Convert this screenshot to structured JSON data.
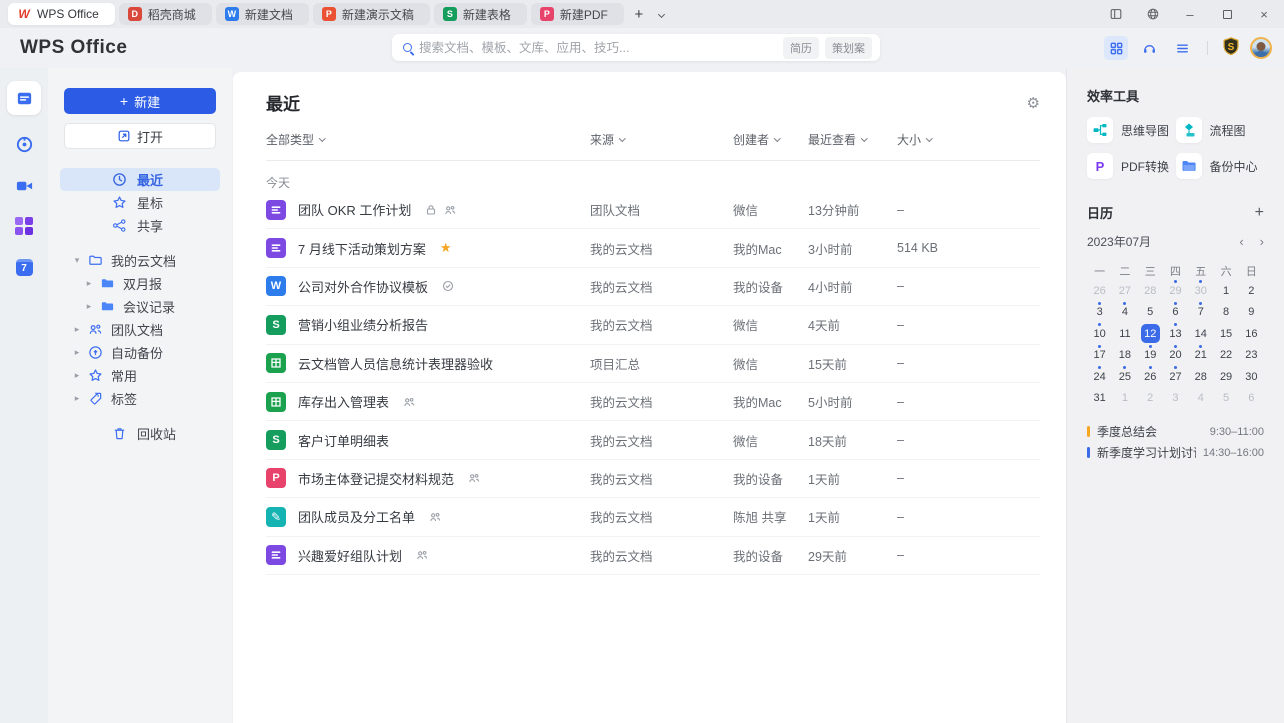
{
  "glyphs": {
    "plus": "+",
    "minimize": "–",
    "close": "×",
    "prev": "‹",
    "next": "›"
  },
  "colors": {
    "accent_blue": "#2c5ce5",
    "writer_blue": "#2d7ceb",
    "presentation_orange": "#eb5233",
    "spreadsheet_green": "#159d5d",
    "pdf_rose": "#e8436a",
    "docs_purple": "#7d49e3",
    "smartdoc_teal": "#16b3b3",
    "docer_red": "#d9483b",
    "star_orange": "#f5a623",
    "selected_day_blue": "#3b6be8"
  },
  "tabbar": {
    "tabs": [
      {
        "label": "WPS Office",
        "glyph": "W",
        "active": true
      },
      {
        "label": "稻壳商城",
        "glyph": "D"
      },
      {
        "label": "新建文档",
        "glyph": "W"
      },
      {
        "label": "新建演示文稿",
        "glyph": "P"
      },
      {
        "label": "新建表格",
        "glyph": "S"
      },
      {
        "label": "新建PDF",
        "glyph": "P"
      }
    ]
  },
  "header": {
    "logo": "WPS Office",
    "search": {
      "placeholder": "搜索文档、模板、文库、应用、技巧...",
      "tags": [
        "简历",
        "策划案"
      ]
    },
    "icons": [
      "apps-grid-icon",
      "support-headset-icon",
      "menu-icon",
      "member-shield-icon",
      "avatar"
    ]
  },
  "rail": {
    "items": [
      "docs-icon",
      "meeting-icon",
      "video-icon",
      "apps-icon",
      "calendar-icon"
    ]
  },
  "sidebar": {
    "new_button": "新建",
    "open_button": "打开",
    "nav": [
      {
        "label": "最近",
        "icon": "clock",
        "active": true
      },
      {
        "label": "星标",
        "icon": "star"
      },
      {
        "label": "共享",
        "icon": "share"
      }
    ],
    "tree": [
      {
        "label": "我的云文档",
        "icon": "folder-open",
        "expanded": true,
        "children": [
          {
            "label": "双月报"
          },
          {
            "label": "会议记录"
          }
        ]
      },
      {
        "label": "团队文档",
        "icon": "team"
      },
      {
        "label": "自动备份",
        "icon": "cloud-backup"
      },
      {
        "label": "常用",
        "icon": "star"
      },
      {
        "label": "标签",
        "icon": "tag"
      }
    ],
    "trash": "回收站"
  },
  "main": {
    "title": "最近",
    "filters": [
      "全部类型",
      "来源",
      "创建者",
      "最近查看",
      "大小"
    ],
    "section_label": "今天",
    "rows": [
      {
        "type": "docs",
        "name": "团队 OKR 工作计划",
        "badges": [
          "lock",
          "members"
        ],
        "source": "团队文档",
        "creator": "微信",
        "viewed": "13分钟前",
        "size": "–"
      },
      {
        "type": "docs",
        "name": "7 月线下活动策划方案",
        "badges": [
          "star"
        ],
        "source": "我的云文档",
        "creator": "我的Mac",
        "viewed": "3小时前",
        "size": "514 KB"
      },
      {
        "type": "word",
        "name": "公司对外合作协议模板",
        "badges": [
          "synced"
        ],
        "source": "我的云文档",
        "creator": "我的设备",
        "viewed": "4小时前",
        "size": "–"
      },
      {
        "type": "sheet",
        "name": "营销小组业绩分析报告",
        "badges": [],
        "source": "我的云文档",
        "creator": "微信",
        "viewed": "4天前",
        "size": "–"
      },
      {
        "type": "smartsheet",
        "name": "云文档管人员信息统计表理器验收",
        "badges": [],
        "source": "项目汇总",
        "creator": "微信",
        "viewed": "15天前",
        "size": "–"
      },
      {
        "type": "smartsheet",
        "name": "库存出入管理表",
        "badges": [
          "members"
        ],
        "source": "我的云文档",
        "creator": "我的Mac",
        "viewed": "5小时前",
        "size": "–"
      },
      {
        "type": "sheet",
        "name": "客户订单明细表",
        "badges": [],
        "source": "我的云文档",
        "creator": "微信",
        "viewed": "18天前",
        "size": "–"
      },
      {
        "type": "pdf",
        "name": "市场主体登记提交材料规范",
        "badges": [
          "members"
        ],
        "source": "我的云文档",
        "creator": "我的设备",
        "viewed": "1天前",
        "size": "–"
      },
      {
        "type": "smartdoc",
        "name": "团队成员及分工名单",
        "badges": [
          "members"
        ],
        "source": "我的云文档",
        "creator": "陈旭 共享",
        "viewed": "1天前",
        "size": "–"
      },
      {
        "type": "docs",
        "name": "兴趣爱好组队计划",
        "badges": [
          "members"
        ],
        "source": "我的云文档",
        "creator": "我的设备",
        "viewed": "29天前",
        "size": "–"
      }
    ]
  },
  "right_panel": {
    "tools_title": "效率工具",
    "tools": [
      {
        "label": "思维导图",
        "icon": "mindmap-icon"
      },
      {
        "label": "流程图",
        "icon": "flowchart-icon"
      },
      {
        "label": "PDF转换",
        "icon": "pdf-convert-icon"
      },
      {
        "label": "备份中心",
        "icon": "backup-folder-icon"
      }
    ],
    "calendar": {
      "title": "日历",
      "month": "2023年07月",
      "weekdays": [
        "一",
        "二",
        "三",
        "四",
        "五",
        "六",
        "日"
      ],
      "weeks": [
        [
          {
            "d": 26,
            "muted": 1
          },
          {
            "d": 27,
            "muted": 1
          },
          {
            "d": 28,
            "muted": 1
          },
          {
            "d": 29,
            "muted": 1,
            "dot": 1
          },
          {
            "d": 30,
            "muted": 1,
            "dot": 1
          },
          {
            "d": 1
          },
          {
            "d": 2
          }
        ],
        [
          {
            "d": 3,
            "dot": 1
          },
          {
            "d": 4,
            "dot": 1
          },
          {
            "d": 5
          },
          {
            "d": 6,
            "dot": 1
          },
          {
            "d": 7,
            "dot": 1
          },
          {
            "d": 8
          },
          {
            "d": 9
          }
        ],
        [
          {
            "d": 10,
            "dot": 1
          },
          {
            "d": 11
          },
          {
            "d": 12,
            "selected": 1
          },
          {
            "d": 13,
            "dot": 1
          },
          {
            "d": 14
          },
          {
            "d": 15
          },
          {
            "d": 16
          }
        ],
        [
          {
            "d": 17,
            "dot": 1
          },
          {
            "d": 18
          },
          {
            "d": 19,
            "dot": 1
          },
          {
            "d": 20,
            "dot": 1
          },
          {
            "d": 21,
            "dot": 1
          },
          {
            "d": 22
          },
          {
            "d": 23
          }
        ],
        [
          {
            "d": 24,
            "dot": 1
          },
          {
            "d": 25,
            "dot": 1
          },
          {
            "d": 26,
            "dot": 1
          },
          {
            "d": 27,
            "dot": 1
          },
          {
            "d": 28
          },
          {
            "d": 29
          },
          {
            "d": 30
          }
        ],
        [
          {
            "d": 31
          },
          {
            "d": 1,
            "muted": 1
          },
          {
            "d": 2,
            "muted": 1
          },
          {
            "d": 3,
            "muted": 1
          },
          {
            "d": 4,
            "muted": 1
          },
          {
            "d": 5,
            "muted": 1
          },
          {
            "d": 6,
            "muted": 1
          }
        ]
      ]
    },
    "events": [
      {
        "title": "季度总结会",
        "time": "9:30–11:00",
        "color": "#f5a623"
      },
      {
        "title": "新季度学习计划讨论",
        "time": "14:30–16:00",
        "color": "#3b6be8"
      }
    ]
  }
}
